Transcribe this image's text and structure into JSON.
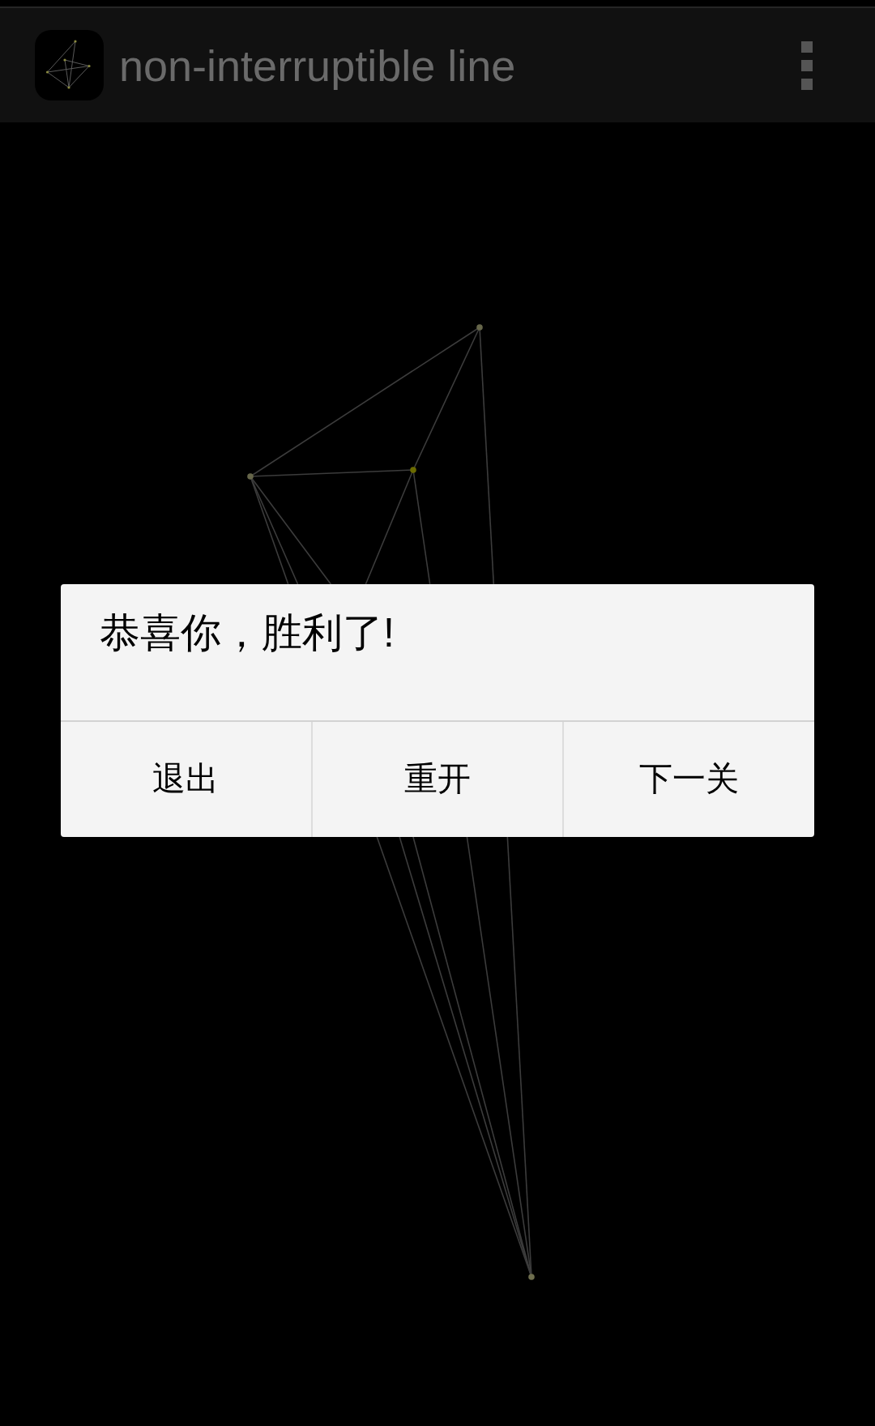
{
  "app_bar": {
    "title": "non-interruptible line"
  },
  "board": {
    "nodes": [
      {
        "color": "#66664a"
      },
      {
        "color": "#66664a"
      },
      {
        "color": "#6b6b00"
      },
      {
        "color": "#6e6e4e"
      }
    ]
  },
  "dialog": {
    "message": "恭喜你，胜利了!",
    "buttons": [
      {
        "label": "退出"
      },
      {
        "label": "重开"
      },
      {
        "label": "下一关"
      }
    ]
  }
}
